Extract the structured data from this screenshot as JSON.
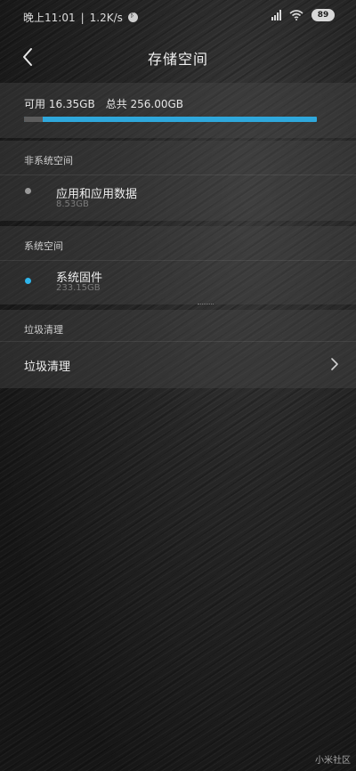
{
  "status_bar": {
    "time": "晚上11:01",
    "speed": "1.2K/s",
    "battery": "89",
    "icons": [
      "bluetooth-icon",
      "signal-icon",
      "wifi-icon",
      "battery-icon"
    ]
  },
  "header": {
    "title": "存储空间",
    "back_icon": "chevron-left-icon"
  },
  "storage": {
    "available_label": "可用 16.35GB",
    "total_label": "总共 256.00GB",
    "used_fraction": 0.936,
    "bar_color": "#2fa8dc"
  },
  "non_system_section": {
    "header": "非系统空间",
    "item": {
      "title": "应用和应用数据",
      "size": "8.53GB",
      "dot_color": "#9a9a9a"
    }
  },
  "system_section": {
    "header": "系统空间",
    "item": {
      "title": "系统固件",
      "size": "233.15GB",
      "dot_color": "#2fb6ec"
    }
  },
  "cleanup_section": {
    "header": "垃圾清理",
    "row_label": "垃圾清理",
    "chevron_icon": "chevron-right-icon"
  },
  "watermark": "小米社区"
}
